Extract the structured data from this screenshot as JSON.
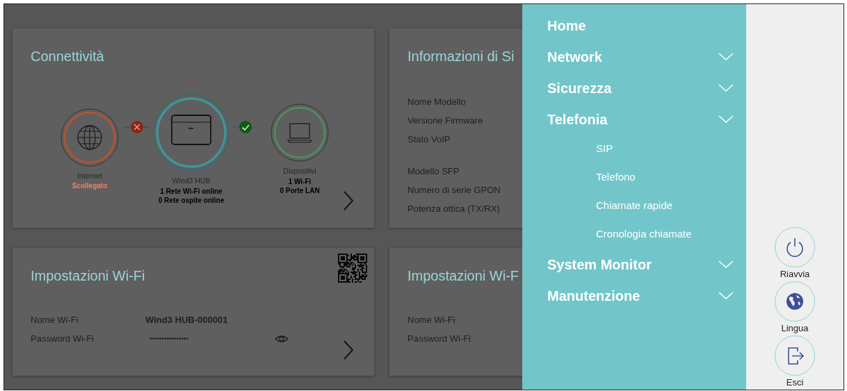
{
  "connectivity": {
    "title": "Connettività",
    "nodes": [
      {
        "kind": "internet",
        "label": "Internet",
        "color": "#c0502f",
        "details": [
          {
            "text": "Scollegato",
            "alert": true
          }
        ]
      },
      {
        "kind": "hub",
        "label": "Wind3 HUB",
        "color": "#3f9599",
        "details": [
          {
            "text": "1 Rete Wi-Fi online",
            "alert": false
          },
          {
            "text": "0 Rete ospite online",
            "alert": false
          }
        ]
      },
      {
        "kind": "devices",
        "label": "Dispositivi",
        "color": "#4f8f5e",
        "details": [
          {
            "text": "1 Wi-Fi",
            "alert": false
          },
          {
            "text": "0 Porte LAN",
            "alert": false
          }
        ]
      }
    ],
    "links": [
      {
        "connected": false
      },
      {
        "connected": true
      }
    ]
  },
  "system_info": {
    "title": "Informazioni di Si",
    "groups": [
      [
        "Nome Modello",
        "Versione Firmware",
        "Stato VoIP"
      ],
      [
        "Modello SFP",
        "Numero di serie GPON",
        "Potenza ottica (TX/RX)"
      ]
    ]
  },
  "wifi": {
    "title": "Impostazioni Wi-Fi",
    "fields": [
      {
        "kind": "text",
        "label": "Nome Wi-Fi",
        "value": "Wind3 HUB-000001"
      },
      {
        "kind": "password",
        "label": "Password Wi-Fi",
        "value": "••••••••••••••••"
      }
    ]
  },
  "wifi_guest": {
    "title": "Impostazioni Wi-F",
    "labels": [
      "Nome Wi-Fi",
      "Password Wi-Fi"
    ]
  },
  "menu": [
    {
      "label": "Home",
      "expandable": false
    },
    {
      "label": "Network",
      "expandable": true
    },
    {
      "label": "Sicurezza",
      "expandable": true
    },
    {
      "label": "Telefonia",
      "expandable": true,
      "children": [
        {
          "label": "SIP"
        },
        {
          "label": "Telefono"
        },
        {
          "label": "Chiamate rapide"
        },
        {
          "label": "Cronologia chiamate"
        }
      ]
    },
    {
      "label": "System Monitor",
      "expandable": true
    },
    {
      "label": "Manutenzione",
      "expandable": true
    }
  ],
  "actions": [
    {
      "kind": "power",
      "label": "Riavvia"
    },
    {
      "kind": "language",
      "label": "Lingua"
    },
    {
      "kind": "logout",
      "label": "Esci"
    }
  ]
}
